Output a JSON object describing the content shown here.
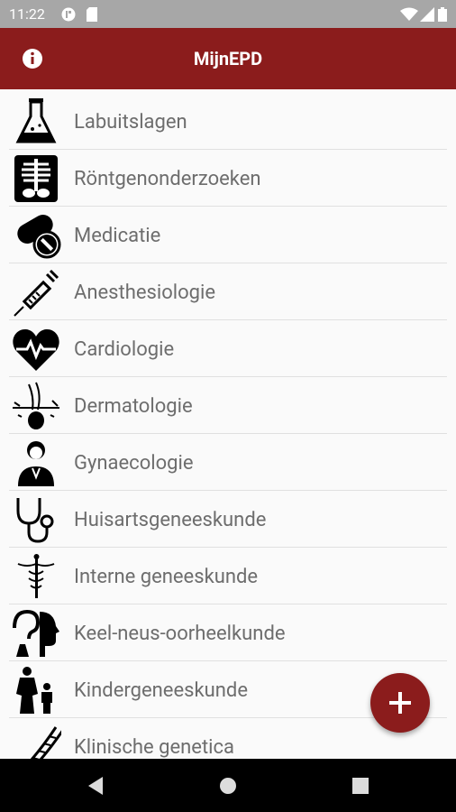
{
  "status_bar": {
    "time": "11:22",
    "icons": [
      "media-icon",
      "sim-card-icon",
      "wifi-icon",
      "signal-icon",
      "battery-icon"
    ]
  },
  "app_bar": {
    "title": "MijnEPD",
    "info_icon": "info-icon",
    "color": "#8b1c1c"
  },
  "list": {
    "items": [
      {
        "label": "Labuitslagen",
        "icon": "flask-icon"
      },
      {
        "label": "Röntgenonderzoeken",
        "icon": "xray-icon"
      },
      {
        "label": "Medicatie",
        "icon": "pills-icon"
      },
      {
        "label": "Anesthesiologie",
        "icon": "syringe-icon"
      },
      {
        "label": "Cardiologie",
        "icon": "heart-icon"
      },
      {
        "label": "Dermatologie",
        "icon": "skin-hair-icon"
      },
      {
        "label": "Gynaecologie",
        "icon": "woman-doctor-icon"
      },
      {
        "label": "Huisartsgeneeskunde",
        "icon": "stethoscope-icon"
      },
      {
        "label": "Interne geneeskunde",
        "icon": "caduceus-icon"
      },
      {
        "label": "Keel-neus-oorheelkunde",
        "icon": "ear-nose-throat-icon"
      },
      {
        "label": "Kindergeneeskunde",
        "icon": "parent-child-icon"
      },
      {
        "label": "Klinische genetica",
        "icon": "dna-icon"
      }
    ]
  },
  "fab": {
    "icon": "plus-icon"
  },
  "nav_bar": {
    "buttons": [
      "back-icon",
      "home-icon",
      "recents-icon"
    ]
  }
}
